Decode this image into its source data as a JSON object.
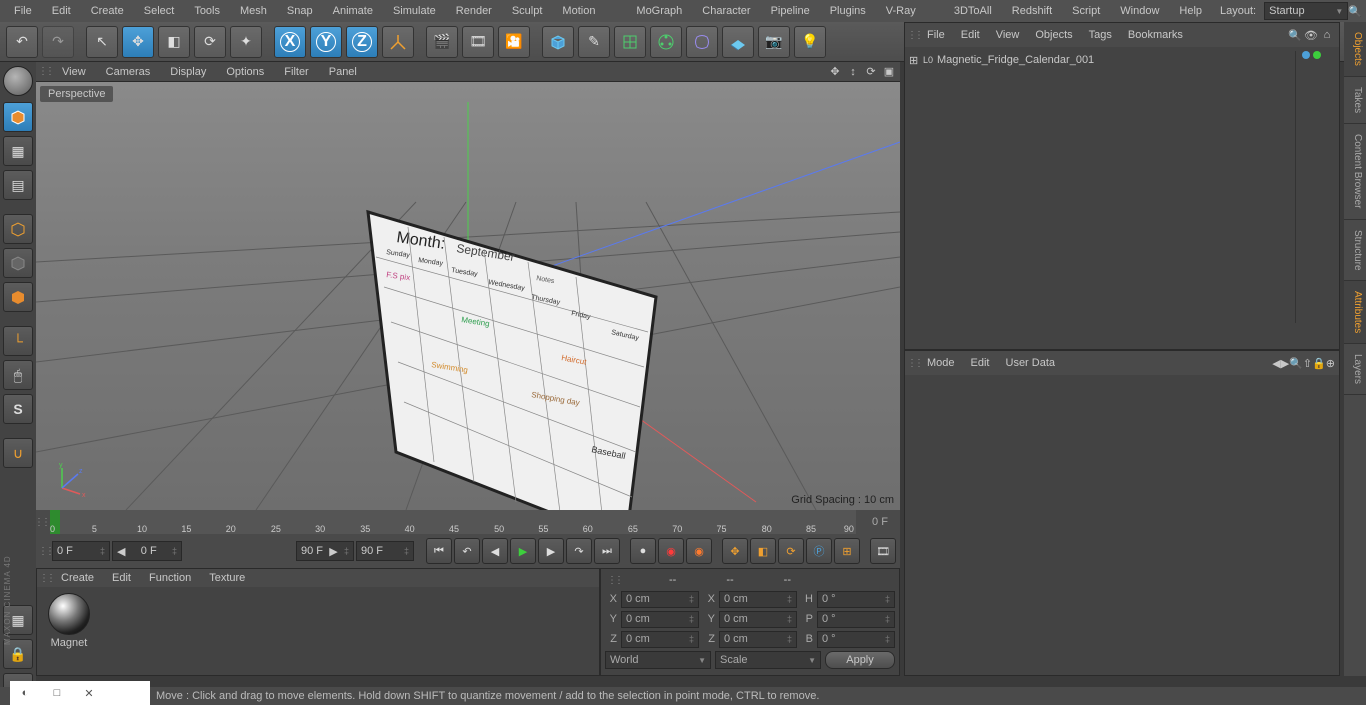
{
  "menubar": [
    "File",
    "Edit",
    "Create",
    "Select",
    "Tools",
    "Mesh",
    "Snap",
    "Animate",
    "Simulate",
    "Render",
    "Sculpt",
    "Motion Tracker",
    "MoGraph",
    "Character",
    "Pipeline",
    "Plugins",
    "V-Ray Bridge",
    "3DToAll",
    "Redshift",
    "Script",
    "Window",
    "Help"
  ],
  "layout": {
    "label": "Layout:",
    "value": "Startup"
  },
  "viewport": {
    "menus": [
      "View",
      "Cameras",
      "Display",
      "Options",
      "Filter",
      "Panel"
    ],
    "label": "Perspective",
    "grid": "Grid Spacing : 10 cm"
  },
  "timeline": {
    "ticks": [
      "0",
      "5",
      "10",
      "15",
      "20",
      "25",
      "30",
      "35",
      "40",
      "45",
      "50",
      "55",
      "60",
      "65",
      "70",
      "75",
      "80",
      "85",
      "90"
    ],
    "end": "  0 F",
    "fields": [
      "0 F",
      "0 F",
      "90 F",
      "90 F"
    ]
  },
  "materials": {
    "menus": [
      "Create",
      "Edit",
      "Function",
      "Texture"
    ],
    "items": [
      "Magnet"
    ]
  },
  "coords": {
    "head": [
      "--",
      "--",
      "--"
    ],
    "rows": [
      {
        "a": "X",
        "av": "0 cm",
        "b": "X",
        "bv": "0 cm",
        "c": "H",
        "cv": "0 °"
      },
      {
        "a": "Y",
        "av": "0 cm",
        "b": "Y",
        "bv": "0 cm",
        "c": "P",
        "cv": "0 °"
      },
      {
        "a": "Z",
        "av": "0 cm",
        "b": "Z",
        "bv": "0 cm",
        "c": "B",
        "cv": "0 °"
      }
    ],
    "world": "World",
    "scale": "Scale",
    "apply": "Apply"
  },
  "objects": {
    "menus": [
      "File",
      "Edit",
      "View",
      "Objects",
      "Tags",
      "Bookmarks"
    ],
    "item": "Magnetic_Fridge_Calendar_001"
  },
  "attrs": {
    "menus": [
      "Mode",
      "Edit",
      "User Data"
    ]
  },
  "rtabs": [
    "Objects",
    "Takes",
    "Content Browser",
    "Structure",
    "Attributes",
    "Layers"
  ],
  "status": "Move : Click and drag to move elements. Hold down SHIFT to quantize movement / add to the selection in point mode, CTRL to remove.",
  "brand": "MAXON CINEMA 4D"
}
